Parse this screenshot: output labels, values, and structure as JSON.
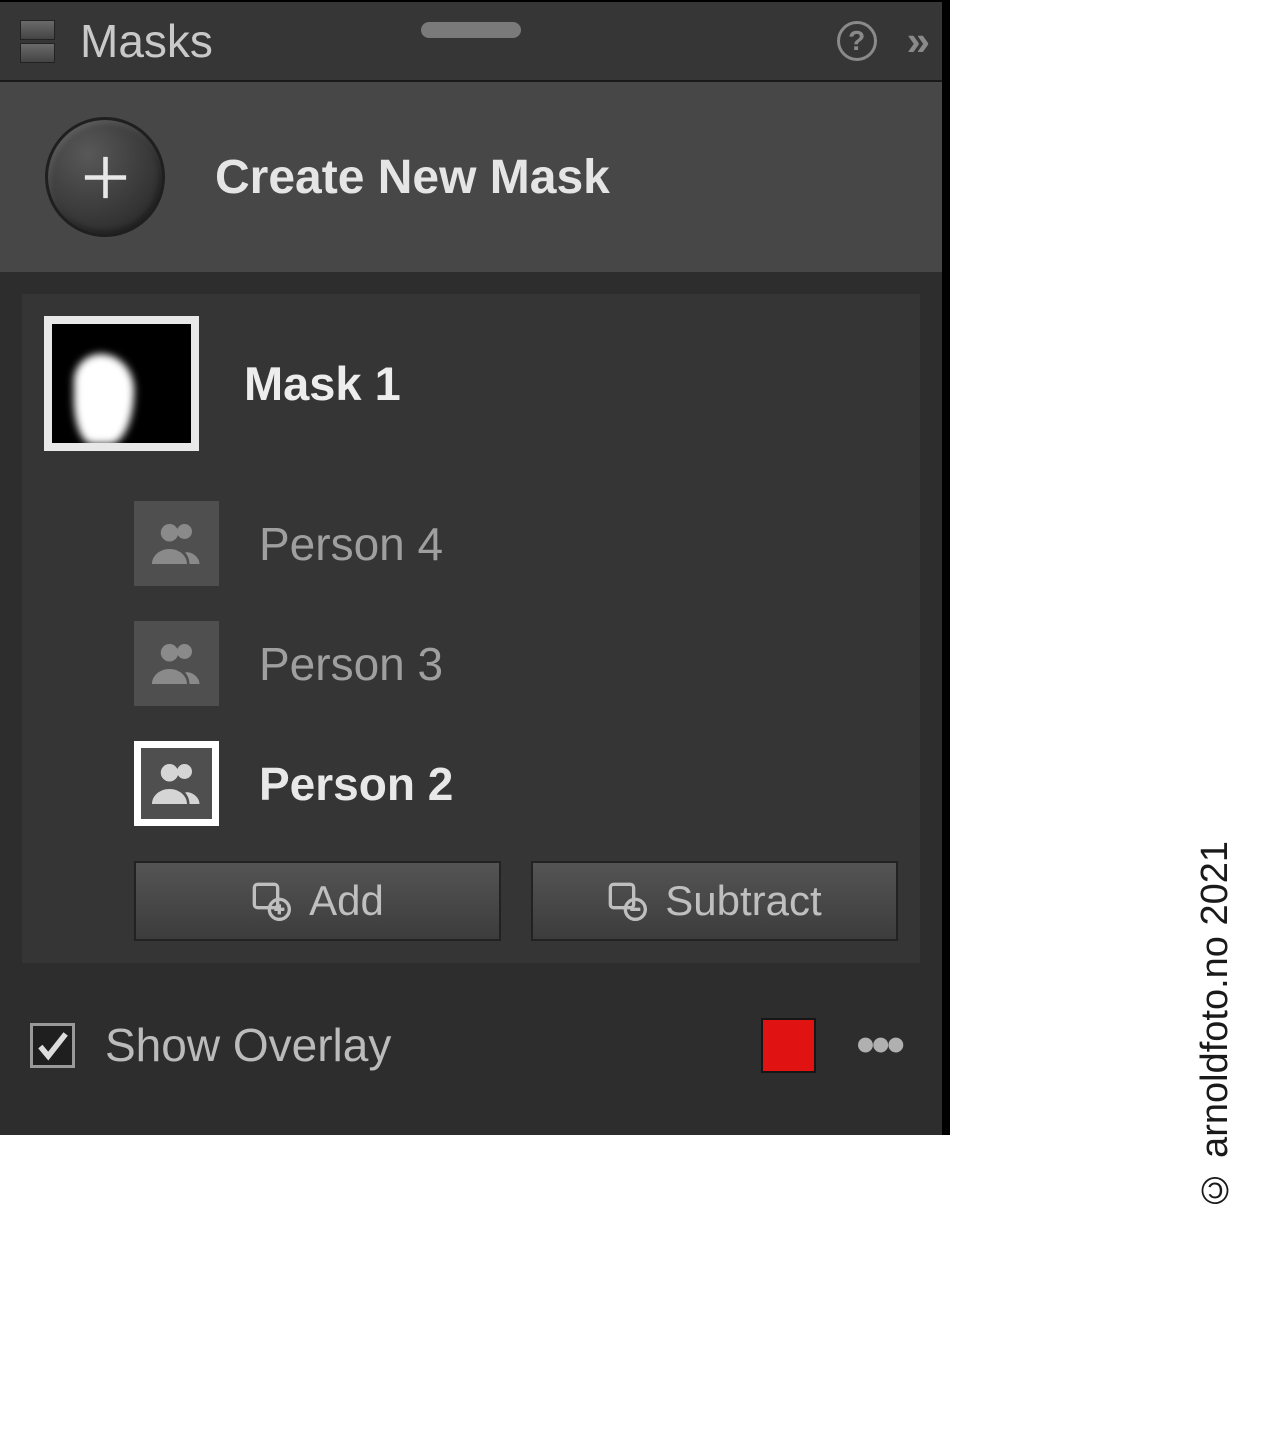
{
  "panel": {
    "title": "Masks",
    "create_label": "Create New Mask"
  },
  "mask": {
    "name": "Mask 1",
    "components": [
      {
        "label": "Person 4",
        "selected": false
      },
      {
        "label": "Person 3",
        "selected": false
      },
      {
        "label": "Person 2",
        "selected": true
      }
    ]
  },
  "actions": {
    "add": "Add",
    "subtract": "Subtract"
  },
  "footer": {
    "show_overlay": "Show Overlay",
    "overlay_checked": true,
    "overlay_color": "#e11212"
  },
  "copyright": "© arnoldfoto.no 2021"
}
